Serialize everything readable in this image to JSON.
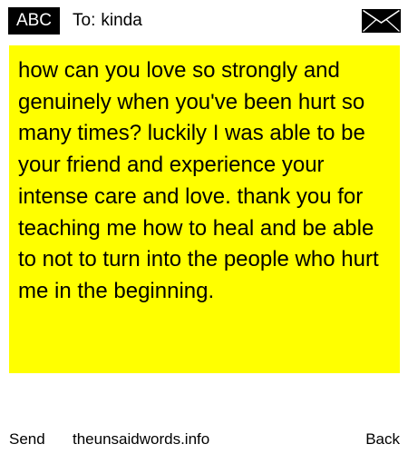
{
  "header": {
    "mode_badge": "ABC",
    "to_prefix": "To:",
    "recipient": "kinda",
    "envelope_icon": "envelope-icon"
  },
  "message": {
    "text": "how can you love so strongly and genuinely when you've been hurt so many times? luckily I was able to be your friend and experience your intense care and love. thank you for teaching me how to heal and be able to not to turn into the people who hurt me in the beginning.",
    "background_color": "#ffff00"
  },
  "footer": {
    "send_label": "Send",
    "site_label": "theunsaidwords.info",
    "back_label": "Back"
  }
}
